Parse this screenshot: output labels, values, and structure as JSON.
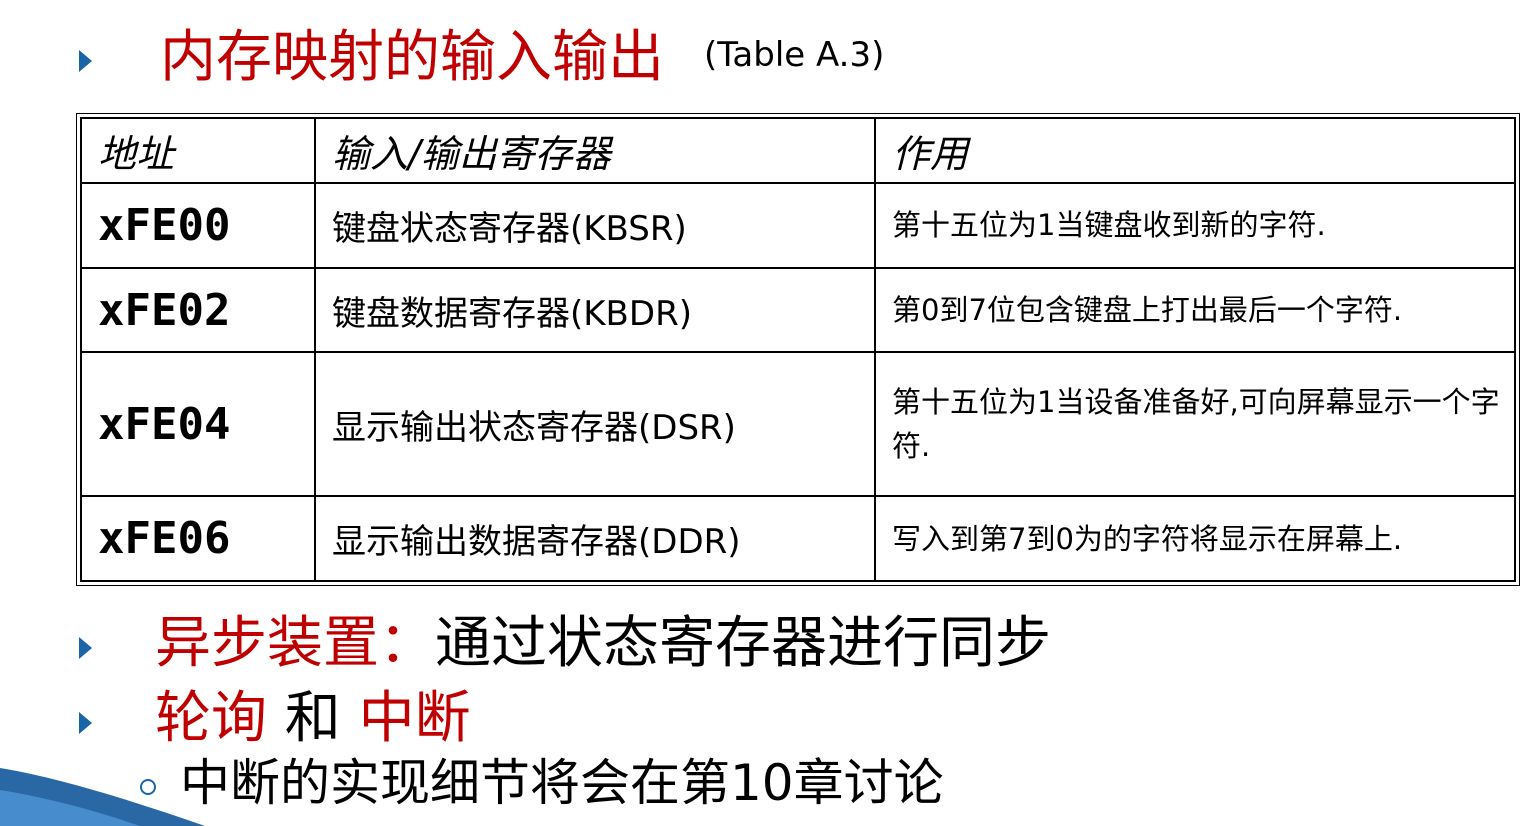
{
  "title": {
    "main": "内存映射的输入输出",
    "ref": "(Table A.3)"
  },
  "table": {
    "headers": [
      "地址",
      "输入/输出寄存器",
      "作用"
    ],
    "rows": [
      {
        "address": "xFE00",
        "register": "键盘状态寄存器(KBSR)",
        "function": "第十五位为1当键盘收到新的字符."
      },
      {
        "address": "xFE02",
        "register": "键盘数据寄存器(KBDR)",
        "function": "第0到7位包含键盘上打出最后一个字符."
      },
      {
        "address": "xFE04",
        "register": "显示输出状态寄存器(DSR)",
        "function": "第十五位为1当设备准备好,可向屏幕显示一个字符."
      },
      {
        "address": "xFE06",
        "register": "显示输出数据寄存器(DDR)",
        "function": "写入到第7到0为的字符将显示在屏幕上."
      }
    ]
  },
  "bullets": [
    {
      "red": "异步装置：",
      "black": "通过状态寄存器进行同步"
    },
    {
      "red1": "轮询",
      "black": " 和 ",
      "red2": "中断"
    }
  ],
  "sub_bullet": "中断的实现细节将会在第10章讨论",
  "colors": {
    "accent_red": "#c00000",
    "bullet_blue": "#1a64a8",
    "deco_blue": "#1d5fa0"
  }
}
